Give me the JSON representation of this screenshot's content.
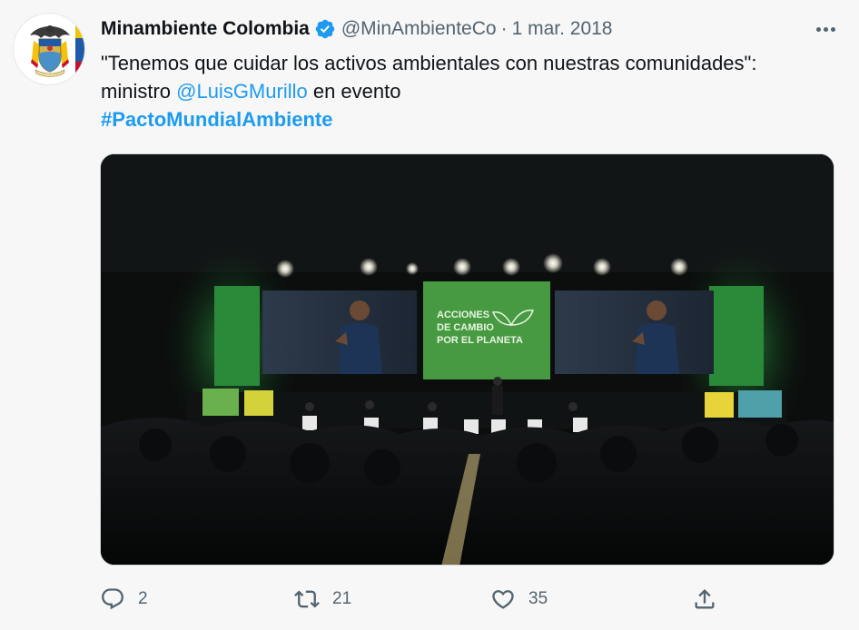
{
  "tweet": {
    "author": {
      "display_name": "Minambiente Colombia",
      "handle": "@MinAmbienteCo",
      "verified": true,
      "avatar_icon": "colombia-coat-of-arms-icon"
    },
    "separator": "·",
    "date": "1 mar. 2018",
    "text": {
      "part1": "\"Tenemos que cuidar los activos ambientales con nuestras comunidades\": ministro ",
      "mention": "@LuisGMurillo",
      "part2": " en evento ",
      "hashtag": "#PactoMundialAmbiente"
    },
    "media": {
      "screen_text_lines": [
        "ACCIONES",
        "DE CAMBIO",
        "POR EL PLANETA"
      ]
    },
    "actions": {
      "reply_count": "2",
      "retweet_count": "21",
      "like_count": "35"
    }
  },
  "colors": {
    "link": "#1d9bf0",
    "verified": "#1d9bf0",
    "secondary_text": "#536471",
    "background": "#f7f7f7"
  }
}
